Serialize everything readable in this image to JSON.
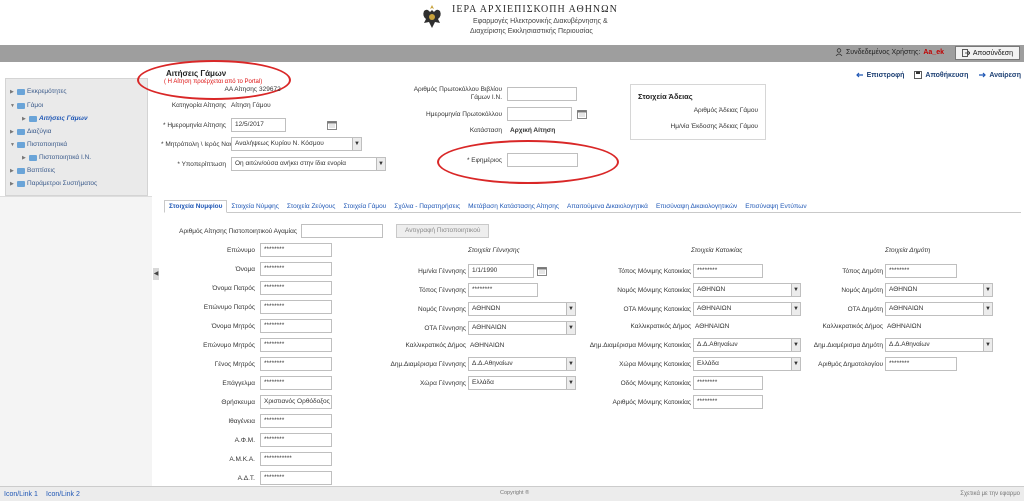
{
  "header": {
    "title": "ΙΕΡΑ ΑΡΧΙΕΠΙΣΚΟΠΗ ΑΘΗΝΩΝ",
    "subtitle1": "Εφαρμογές Ηλεκτρονικής Διακυβέρνησης &",
    "subtitle2": "Διαχείρισης Εκκλησιαστικής Περιουσίας"
  },
  "userbar": {
    "user_label": "Συνδεδεμένος Χρήστης:",
    "user_name": "Aa_ek",
    "logout_label": "Αποσύνδεση"
  },
  "sidebar": {
    "items": [
      {
        "label": "Εκκρεμότητες"
      },
      {
        "label": "Γάμοι"
      },
      {
        "label": "Αιτήσεις Γάμων"
      },
      {
        "label": "Διαζύγια"
      },
      {
        "label": "Πιστοποιητικά"
      },
      {
        "label": "Πιστοποιητικά Ι.Ν."
      },
      {
        "label": "Βαπτίσεις"
      },
      {
        "label": "Παράμετροι Συστήματος"
      }
    ]
  },
  "page": {
    "title": "Αιτήσεις Γάμων",
    "note": "( Η Αίτηση προέρχεται από το Portal)"
  },
  "toolbar": {
    "back": "Επιστροφή",
    "save": "Αποθήκευση",
    "remove": "Αναίρεση"
  },
  "form": {
    "aa_label": "ΑΑ Αίτησης",
    "aa_value": "329672",
    "category_label": "Κατηγορία Αίτησης",
    "category_value": "Αίτηση Γάμου",
    "date_label": "Ημερομηνία Αίτησης",
    "date_value": "12/5/2017",
    "metropolis_label": "Μητρόπολη \\ Ιερός Ναός",
    "metropolis_value": "Αναλήψεως Κυρίου Ν. Κόσμου",
    "subcase_label": "Υποπερίπτωση",
    "subcase_value": "Οη αιτών/ούσα ανήκει στην ίδια ενορία",
    "protocol_book_label1": "Αριθμός Πρωτοκόλλου Βιβλίου",
    "protocol_book_label2": "Γάμων Ι.Ν.",
    "protocol_date_label": "Ημερομηνία Πρωτοκόλλου",
    "status_label": "Κατάσταση",
    "status_value": "Αρχική Αίτηση",
    "priest_label": "Εφημέριος"
  },
  "license": {
    "heading": "Στοιχεία Άδειας",
    "number_label": "Αριθμός Άδειας Γάμου",
    "date_label": "Ημ/νία Έκδοσης Άδειας Γάμου"
  },
  "tabs": [
    {
      "label": "Στοιχεία Νυμφίου"
    },
    {
      "label": "Στοιχεία Νύμφης"
    },
    {
      "label": "Στοιχεία Ζεύγους"
    },
    {
      "label": "Στοιχεία Γάμου"
    },
    {
      "label": "Σχόλια - Παρατηρήσεις"
    },
    {
      "label": "Μετάβαση Κατάστασης Αίτησης"
    },
    {
      "label": "Απαιτούμενα Δικαιολογητικά"
    },
    {
      "label": "Επισύναψη Δικαιολογητικών"
    },
    {
      "label": "Επισύναψη Εντύπων"
    }
  ],
  "groom": {
    "cert_label": "Αριθμός Αίτησης Πιστοποιητικού Αγαμίας",
    "copy_button": "Αντιγραφή Πιστοποιητικού",
    "personal": [
      {
        "label": "Επώνυμο",
        "value": "********"
      },
      {
        "label": "Όνομα",
        "value": "********"
      },
      {
        "label": "Όνομα Πατρός",
        "value": "********"
      },
      {
        "label": "Επώνυμο Πατρός",
        "value": "********"
      },
      {
        "label": "Όνομα Μητρός",
        "value": "********"
      },
      {
        "label": "Επώνυμο Μητρός",
        "value": "********"
      },
      {
        "label": "Γένος Μητρός",
        "value": "********"
      },
      {
        "label": "Επάγγελμα",
        "value": "********"
      },
      {
        "label": "Θρήσκευμα",
        "value": "Χριστιανός Ορθόδοξος"
      },
      {
        "label": "Ιθαγένεια",
        "value": "********"
      },
      {
        "label": "Α.Φ.Μ.",
        "value": "********"
      },
      {
        "label": "Α.Μ.Κ.Α.",
        "value": "***********"
      },
      {
        "label": "Α.Δ.Τ.",
        "value": "********"
      }
    ],
    "birth": {
      "heading": "Στοιχεία Γέννησης",
      "date_label": "Ημ/νία Γέννησης",
      "date_value": "1/1/1990",
      "place_label": "Τόπος Γέννησης",
      "place_value": "********",
      "prefecture_label": "Νομός Γέννησης",
      "prefecture_value": "ΑΘΗΝΩΝ",
      "ota_label": "ΟΤΑ Γέννησης",
      "ota_value": "ΑΘΗΝΑΙΩΝ",
      "kallikratis_label": "Καλλικρατικός Δήμος",
      "kallikratis_value": "ΑΘΗΝΑΙΩΝ",
      "district_label": "Δημ.Διαμέρισμα Γέννησης",
      "district_value": "Δ.Δ.Αθηναίων",
      "country_label": "Χώρα Γέννησης",
      "country_value": "Ελλάδα"
    },
    "residence": {
      "heading": "Στοιχεία Κατοικίας",
      "place_label": "Τόπος Μόνιμης Κατοικίας",
      "place_value": "********",
      "prefecture_label": "Νομός Μόνιμης Κατοικίας",
      "prefecture_value": "ΑΘΗΝΩΝ",
      "ota_label": "ΟΤΑ Μόνιμης Κατοικίας",
      "ota_value": "ΑΘΗΝΑΙΩΝ",
      "kallikratis_label": "Καλλικρατικός Δήμος",
      "kallikratis_value": "ΑΘΗΝΑΙΩΝ",
      "district_label": "Δημ.Διαμέρισμα Μόνιμης Κατοικίας",
      "district_value": "Δ.Δ.Αθηναίων",
      "country_label": "Χώρα Μόνιμης Κατοικίας",
      "country_value": "Ελλάδα",
      "street_label": "Οδός Μόνιμης Κατοικίας",
      "street_value": "********",
      "number_label": "Αριθμός Μόνιμης Κατοικίας",
      "number_value": "********"
    },
    "municipality": {
      "heading": "Στοιχεία Δημότη",
      "place_label": "Τόπος Δημότη",
      "place_value": "********",
      "prefecture_label": "Νομός Δημότη",
      "prefecture_value": "ΑΘΗΝΩΝ",
      "ota_label": "ΟΤΑ Δημότη",
      "ota_value": "ΑΘΗΝΑΙΩΝ",
      "kallikratis_label": "Καλλικρατικός Δήμος",
      "kallikratis_value": "ΑΘΗΝΑΙΩΝ",
      "district_label": "Δημ.Διαμέρισμα Δημότη",
      "district_value": "Δ.Δ.Αθηναίων",
      "registry_label": "Αριθμός Δημοτολογίου",
      "registry_value": "********"
    }
  },
  "footer": {
    "link1": "Icon/Link 1",
    "link2": "Icon/Link 2",
    "copyright": "Copyright ®",
    "right": "Σχετικά με την εφαρμο"
  }
}
